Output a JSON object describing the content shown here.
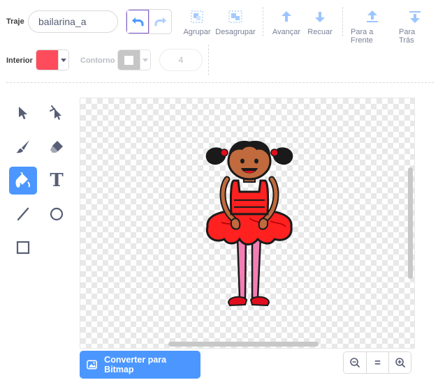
{
  "costume": {
    "label": "Traje",
    "name": "bailarina_a"
  },
  "toolbar": {
    "group_label": "Agrupar",
    "ungroup_label": "Desagrupar",
    "forward_label": "Avançar",
    "backward_label": "Recuar",
    "front_label": "Para a Frente",
    "back_label": "Para Trás"
  },
  "style": {
    "fill_label": "Interior",
    "fill_color": "#ff4c5c",
    "outline_label": "Contorno",
    "outline_color": "#b3b3b3",
    "outline_width": "4"
  },
  "tools": [
    {
      "name": "select-tool",
      "icon": "arrow-icon"
    },
    {
      "name": "reshape-tool",
      "icon": "reshape-icon"
    },
    {
      "name": "brush-tool",
      "icon": "brush-icon"
    },
    {
      "name": "eraser-tool",
      "icon": "eraser-icon"
    },
    {
      "name": "fill-tool",
      "icon": "bucket-icon",
      "selected": true
    },
    {
      "name": "text-tool",
      "icon": "text-icon"
    },
    {
      "name": "line-tool",
      "icon": "line-icon"
    },
    {
      "name": "circle-tool",
      "icon": "circle-icon"
    },
    {
      "name": "rect-tool",
      "icon": "rect-icon"
    }
  ],
  "text_tool_glyph": "T",
  "bitmap_button": {
    "label": "Converter para Bitmap"
  },
  "zoom": {
    "reset_label": "="
  },
  "colors": {
    "accent": "#4c97ff",
    "icon": "#575e75",
    "disabled_icon": "#4c97ff"
  }
}
